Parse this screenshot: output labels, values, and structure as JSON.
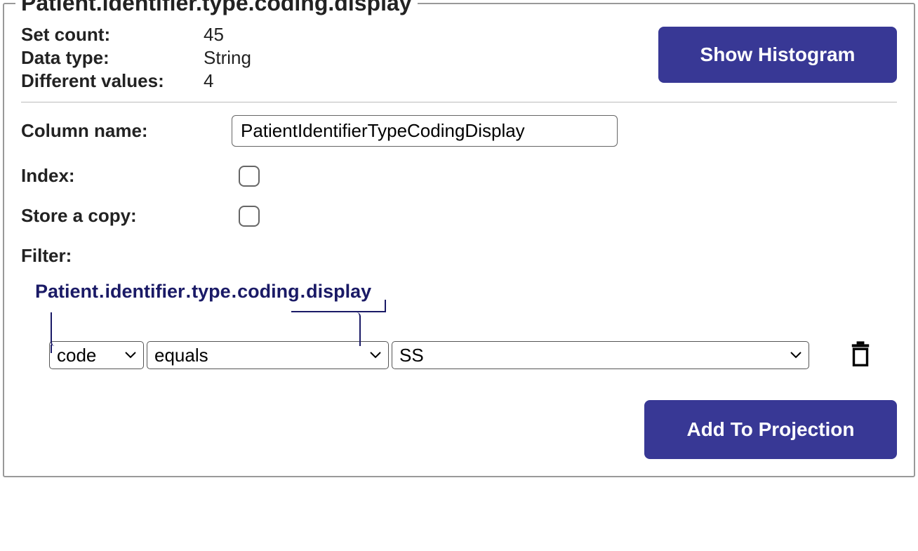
{
  "legend": "Patient.identifier.type.coding.display",
  "info": {
    "set_count_label": "Set count:",
    "set_count_value": "45",
    "data_type_label": "Data type:",
    "data_type_value": "String",
    "diff_values_label": "Different values:",
    "diff_values_value": "4"
  },
  "buttons": {
    "histogram": "Show Histogram",
    "add_projection": "Add To Projection"
  },
  "form": {
    "column_name_label": "Column name:",
    "column_name_value": "PatientIdentifierTypeCodingDisplay",
    "index_label": "Index:",
    "store_copy_label": "Store a copy:",
    "filter_label": "Filter:"
  },
  "path": {
    "segments": [
      "Patient",
      "identifier",
      "type",
      "coding",
      "display"
    ]
  },
  "filter_row": {
    "field": "code",
    "operator": "equals",
    "value": "SS"
  }
}
